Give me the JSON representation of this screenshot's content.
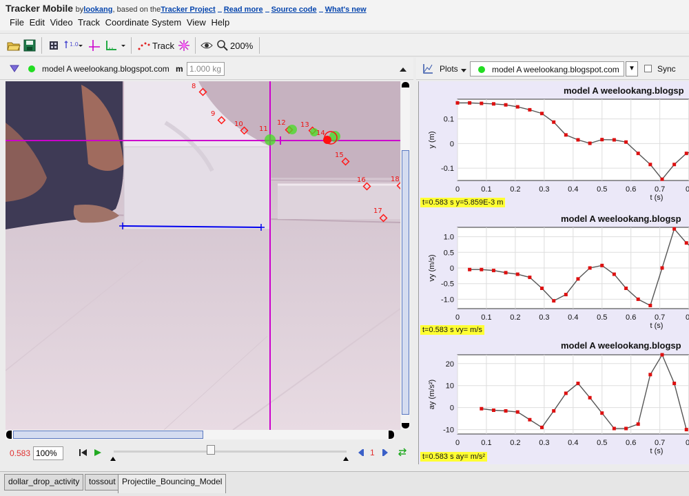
{
  "title_bar": {
    "app_name": "Tracker Mobile",
    "by_prefix": "by",
    "author": "lookang",
    "based_on": ", based on the",
    "project_link": "Tracker Project",
    "read_more": "Read more",
    "source_code": "Source code",
    "whats_new": "What's new"
  },
  "menu": [
    "File",
    "Edit",
    "Video",
    "Track",
    "Coordinate System",
    "View",
    "Help"
  ],
  "toolbar": {
    "track_label": "Track",
    "zoom_label": "200%",
    "icons": [
      "open-folder-icon",
      "save-disk-icon",
      "clip-settings-icon",
      "calibration-tool-icon",
      "axes-icon",
      "tape-measure-icon",
      "track-points-icon",
      "autotracker-icon",
      "eye-icon",
      "magnifier-icon"
    ]
  },
  "track_bar": {
    "track_name": "model A weelookang.blogspot.com",
    "mass_symbol": "m",
    "mass_value": "1.000 kg"
  },
  "video": {
    "frame_labels": [
      "8",
      "9",
      "10",
      "11",
      "12",
      "13",
      "14",
      "15",
      "16",
      "17",
      "18"
    ]
  },
  "player": {
    "time": "0.583",
    "rate": "100%",
    "step": "1"
  },
  "plots_bar": {
    "plots_label": "Plots",
    "track_select": "model A weelookang.blogspot.com",
    "sync_label": "Sync"
  },
  "plots": [
    {
      "title": "model A weelookang.blogsp",
      "ylabel": "y (m)",
      "xlabel": "t (s)",
      "readout": "t=0.583 s  y=5.859E-3 m",
      "yticks": [
        "0.1",
        "0",
        "-0.1"
      ],
      "xticks": [
        "0",
        "0.1",
        "0.2",
        "0.3",
        "0.4",
        "0.5",
        "0.6",
        "0.7",
        "0."
      ]
    },
    {
      "title": "model A weelookang.blogsp",
      "ylabel": "vy (m/s)",
      "xlabel": "t (s)",
      "readout": "t=0.583 s  vy= m/s",
      "yticks": [
        "1.0",
        "0.5",
        "0",
        "-0.5",
        "-1.0"
      ],
      "xticks": [
        "0",
        "0.1",
        "0.2",
        "0.3",
        "0.4",
        "0.5",
        "0.6",
        "0.7",
        "0."
      ]
    },
    {
      "title": "model A weelookang.blogsp",
      "ylabel": "ay (m/s²)",
      "xlabel": "t (s)",
      "readout": "t=0.583 s  ay= m/s²",
      "yticks": [
        "20",
        "10",
        "0",
        "-10"
      ],
      "xticks": [
        "0",
        "0.1",
        "0.2",
        "0.3",
        "0.4",
        "0.5",
        "0.6",
        "0.7",
        "0."
      ]
    }
  ],
  "chart_data": [
    {
      "type": "line",
      "title": "model A weelookang.blogsp",
      "xlabel": "t (s)",
      "ylabel": "y (m)",
      "xlim": [
        0,
        0.82
      ],
      "ylim": [
        -0.15,
        0.18
      ],
      "series": [
        {
          "x": [
            0,
            0.042,
            0.083,
            0.125,
            0.167,
            0.208,
            0.25,
            0.292,
            0.333,
            0.375,
            0.417,
            0.458,
            0.5,
            0.542,
            0.583,
            0.625,
            0.667,
            0.708,
            0.75,
            0.792,
            0.82
          ],
          "values": [
            0.165,
            0.165,
            0.163,
            0.161,
            0.157,
            0.149,
            0.137,
            0.122,
            0.087,
            0.035,
            0.015,
            0.001,
            0.016,
            0.015,
            0.006,
            -0.04,
            -0.085,
            -0.145,
            -0.085,
            -0.04,
            -0.03
          ]
        }
      ]
    },
    {
      "type": "line",
      "title": "model A weelookang.blogsp",
      "xlabel": "t (s)",
      "ylabel": "vy (m/s)",
      "xlim": [
        0,
        0.82
      ],
      "ylim": [
        -1.3,
        1.3
      ],
      "series": [
        {
          "x": [
            0.042,
            0.083,
            0.125,
            0.167,
            0.208,
            0.25,
            0.292,
            0.333,
            0.375,
            0.417,
            0.458,
            0.5,
            0.542,
            0.583,
            0.625,
            0.667,
            0.708,
            0.75,
            0.792,
            0.82
          ],
          "values": [
            -0.05,
            -0.05,
            -0.08,
            -0.15,
            -0.2,
            -0.3,
            -0.65,
            -1.05,
            -0.85,
            -0.35,
            0.0,
            0.08,
            -0.2,
            -0.65,
            -1.0,
            -1.2,
            0.0,
            1.25,
            0.8,
            0.6
          ]
        }
      ]
    },
    {
      "type": "line",
      "title": "model A weelookang.blogsp",
      "xlabel": "t (s)",
      "ylabel": "ay (m/s²)",
      "xlim": [
        0,
        0.82
      ],
      "ylim": [
        -12,
        24
      ],
      "series": [
        {
          "x": [
            0.083,
            0.125,
            0.167,
            0.208,
            0.25,
            0.292,
            0.333,
            0.375,
            0.417,
            0.458,
            0.5,
            0.542,
            0.583,
            0.625,
            0.667,
            0.708,
            0.75,
            0.792
          ],
          "values": [
            -0.5,
            -1.2,
            -1.5,
            -2,
            -5.5,
            -9,
            -1.5,
            6.5,
            11,
            4.5,
            -2.5,
            -9.5,
            -9.5,
            -7.5,
            15,
            24,
            11,
            -10
          ]
        }
      ]
    }
  ],
  "tabs": [
    "dollar_drop_activity",
    "tossout",
    "Projectile_Bouncing_Model"
  ],
  "colors": {
    "track": "#ff2020",
    "point_green": "#33cc00",
    "axes": "#cc00cc",
    "tape": "#0000ee",
    "readout": "#ffff33",
    "plot_bg": "#ebe8f8"
  }
}
